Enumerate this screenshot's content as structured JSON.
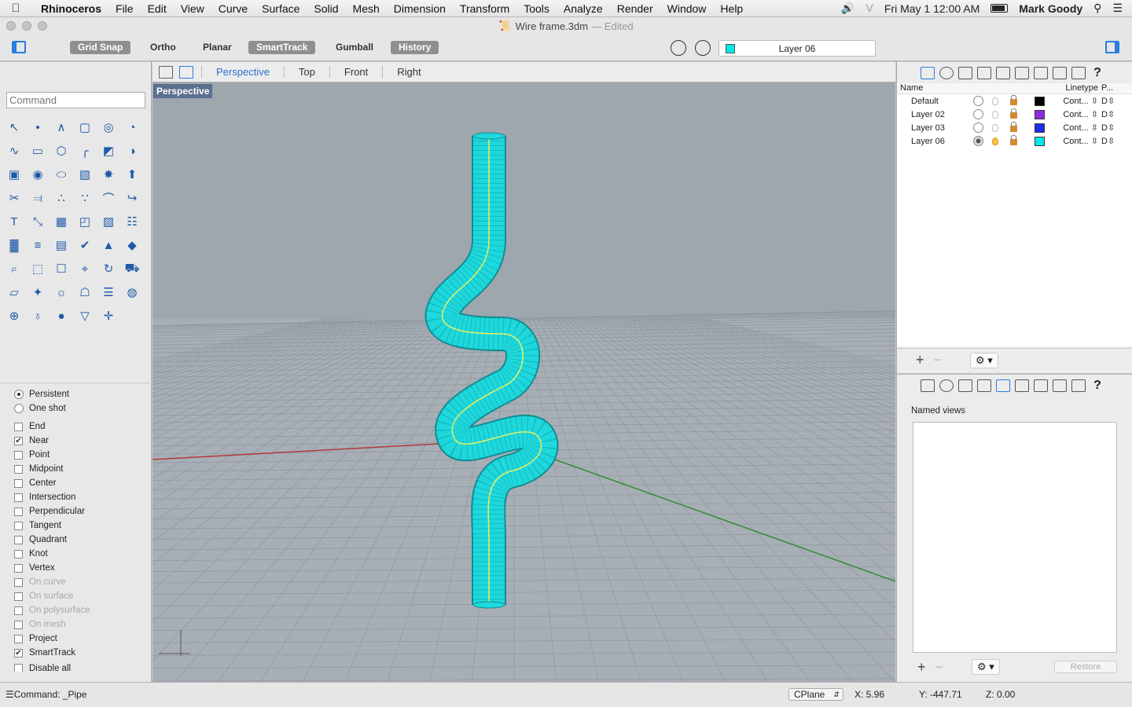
{
  "menubar": {
    "app_name": "Rhinoceros",
    "items": [
      "File",
      "Edit",
      "View",
      "Curve",
      "Surface",
      "Solid",
      "Mesh",
      "Dimension",
      "Transform",
      "Tools",
      "Analyze",
      "Render",
      "Window",
      "Help"
    ],
    "clock": "Fri May 1  12:00 AM",
    "user": "Mark Goody"
  },
  "window": {
    "title": "Wire frame.3dm",
    "edited": "— Edited"
  },
  "toolbar": {
    "grid_snap": "Grid Snap",
    "ortho": "Ortho",
    "planar": "Planar",
    "smarttrack": "SmartTrack",
    "gumball": "Gumball",
    "history": "History",
    "current_layer": "Layer 06",
    "current_layer_color": "#00e8e8"
  },
  "command": {
    "placeholder": "Command"
  },
  "osnaps": {
    "persistent": "Persistent",
    "one_shot": "One shot",
    "items": [
      {
        "label": "End",
        "checked": false,
        "enabled": true
      },
      {
        "label": "Near",
        "checked": true,
        "enabled": true
      },
      {
        "label": "Point",
        "checked": false,
        "enabled": true
      },
      {
        "label": "Midpoint",
        "checked": false,
        "enabled": true
      },
      {
        "label": "Center",
        "checked": false,
        "enabled": true
      },
      {
        "label": "Intersection",
        "checked": false,
        "enabled": true
      },
      {
        "label": "Perpendicular",
        "checked": false,
        "enabled": true
      },
      {
        "label": "Tangent",
        "checked": false,
        "enabled": true
      },
      {
        "label": "Quadrant",
        "checked": false,
        "enabled": true
      },
      {
        "label": "Knot",
        "checked": false,
        "enabled": true
      },
      {
        "label": "Vertex",
        "checked": false,
        "enabled": true
      },
      {
        "label": "On curve",
        "checked": false,
        "enabled": false
      },
      {
        "label": "On surface",
        "checked": false,
        "enabled": false
      },
      {
        "label": "On polysurface",
        "checked": false,
        "enabled": false
      },
      {
        "label": "On mesh",
        "checked": false,
        "enabled": false
      },
      {
        "label": "Project",
        "checked": false,
        "enabled": true
      },
      {
        "label": "SmartTrack",
        "checked": true,
        "enabled": true
      }
    ],
    "disable_all": "Disable all"
  },
  "viewtabs": {
    "perspective": "Perspective",
    "top": "Top",
    "front": "Front",
    "right": "Right"
  },
  "viewport": {
    "label": "Perspective",
    "pipe_color": "#1ed8dc",
    "grid_bg": "#a8aeb6"
  },
  "layers": {
    "col_name": "Name",
    "col_linetype": "Linetype",
    "col_print": "P...",
    "rows": [
      {
        "name": "Default",
        "color": "#000000",
        "linetype": "Cont...",
        "print": "D",
        "current": false
      },
      {
        "name": "Layer 02",
        "color": "#8a2be2",
        "linetype": "Cont...",
        "print": "D",
        "current": false
      },
      {
        "name": "Layer 03",
        "color": "#1a2de8",
        "linetype": "Cont...",
        "print": "D",
        "current": false
      },
      {
        "name": "Layer 06",
        "color": "#00e8e8",
        "linetype": "Cont...",
        "print": "D",
        "current": true
      }
    ]
  },
  "named_views": {
    "title": "Named views",
    "restore": "Restore"
  },
  "status": {
    "command": "Command: _Pipe",
    "cplane": "CPlane",
    "x": "X: 5.96",
    "y": "Y: -447.71",
    "z": "Z: 0.00"
  }
}
